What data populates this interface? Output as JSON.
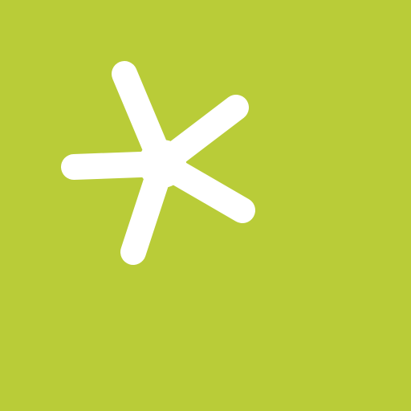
{
  "app_icon": {
    "icon": "asterisk-icon",
    "background_color": "#B9CC38",
    "glyph_color": "#FFFFFF"
  }
}
